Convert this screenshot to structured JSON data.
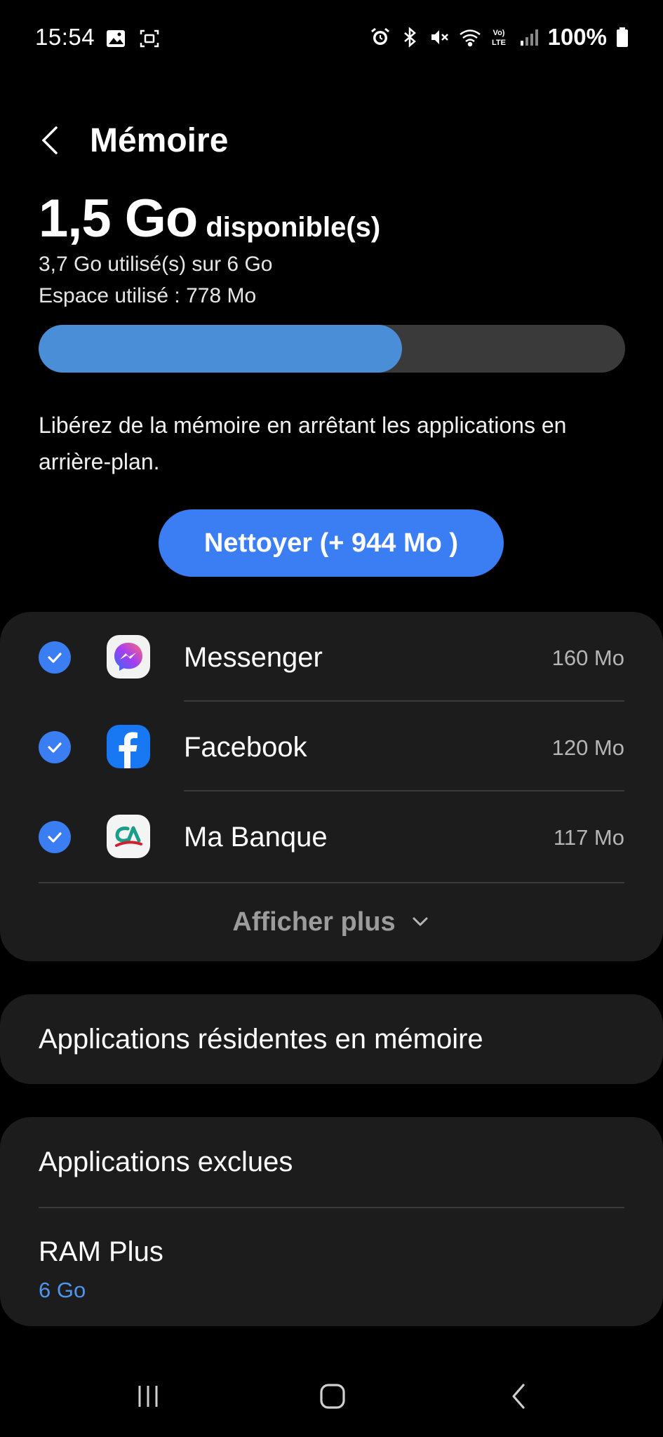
{
  "status_bar": {
    "time": "15:54",
    "battery_percent": "100%",
    "left_icons": [
      "gallery-icon",
      "screen-capture-icon"
    ],
    "right_icons": [
      "alarm-icon",
      "bluetooth-icon",
      "mute-icon",
      "wifi-icon",
      "volte-icon",
      "signal-icon",
      "battery-icon"
    ],
    "volte_label_top": "Vo)",
    "volte_label_bottom": "LTE"
  },
  "header": {
    "title": "Mémoire"
  },
  "memory": {
    "available_value": "1,5 Go",
    "available_label": "disponible(s)",
    "used_text": "3,7 Go utilisé(s) sur 6 Go",
    "space_text": "Espace utilisé : 778 Mo",
    "used_fraction": 0.62,
    "bar_fill_color": "#4a8ed8",
    "bar_track_color": "#3a3a3a"
  },
  "description": "Libérez de la mémoire en arrêtant les applications en arrière-plan.",
  "clean_button": {
    "label": "Nettoyer (+ 944 Mo )",
    "color": "#3b7df2"
  },
  "apps": [
    {
      "name": "Messenger",
      "size": "160 Mo",
      "checked": true,
      "icon": "messenger-icon"
    },
    {
      "name": "Facebook",
      "size": "120 Mo",
      "checked": true,
      "icon": "facebook-icon"
    },
    {
      "name": "Ma Banque",
      "size": "117 Mo",
      "checked": true,
      "icon": "ma-banque-icon"
    }
  ],
  "show_more": {
    "label": "Afficher plus"
  },
  "resident_apps": {
    "label": "Applications résidentes en mémoire"
  },
  "excluded_apps": {
    "label": "Applications exclues"
  },
  "ram_plus": {
    "label": "RAM Plus",
    "value": "6 Go",
    "value_color": "#4e95f0"
  },
  "nav_bar": {
    "buttons": [
      "recent-apps-icon",
      "home-icon",
      "back-icon"
    ]
  }
}
